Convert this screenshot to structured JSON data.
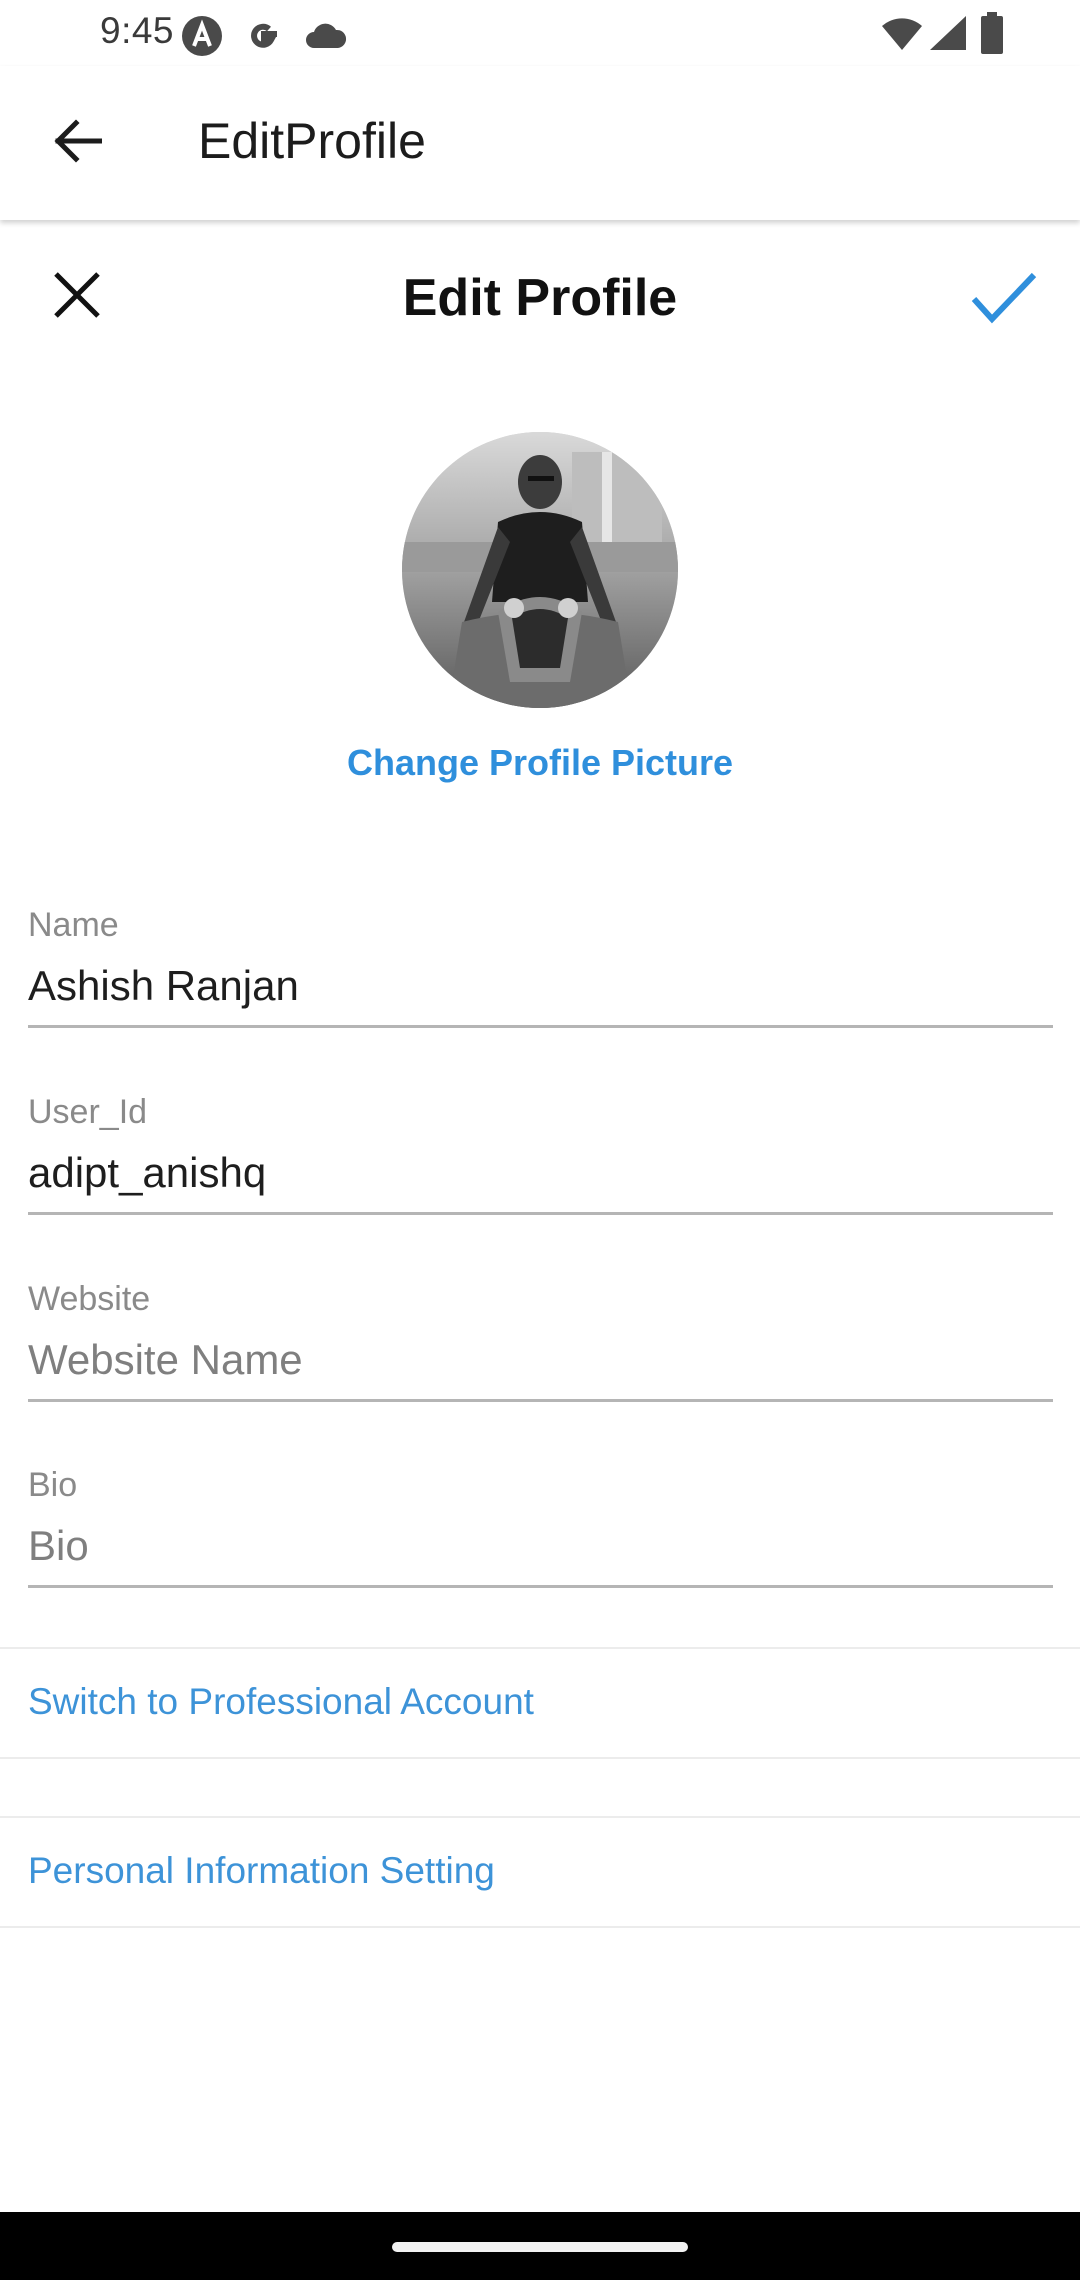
{
  "status_bar": {
    "time": "9:45",
    "icons_left": [
      "app-a-icon",
      "google-icon",
      "cloud-icon"
    ],
    "icons_right": [
      "wifi-icon",
      "signal-icon",
      "battery-icon"
    ]
  },
  "app_bar": {
    "title": "EditProfile",
    "back_icon": "arrow-back-icon"
  },
  "header": {
    "title": "Edit Profile",
    "close_icon": "close-icon",
    "confirm_icon": "check-icon"
  },
  "profile": {
    "change_picture_label": "Change Profile Picture"
  },
  "fields": {
    "name": {
      "label": "Name",
      "value": "Ashish Ranjan"
    },
    "user_id": {
      "label": "User_Id",
      "value": "adipt_anishq"
    },
    "website": {
      "label": "Website",
      "value": "",
      "placeholder": "Website Name"
    },
    "bio": {
      "label": "Bio",
      "value": "",
      "placeholder": "Bio"
    }
  },
  "links": {
    "professional": "Switch to Professional Account",
    "personal_info": "Personal Information Setting"
  },
  "colors": {
    "accent": "#2f8fdc",
    "link": "#3d93d8",
    "text": "#1e1e1e",
    "label": "#8a8a8a",
    "divider": "#b5b5b5"
  }
}
